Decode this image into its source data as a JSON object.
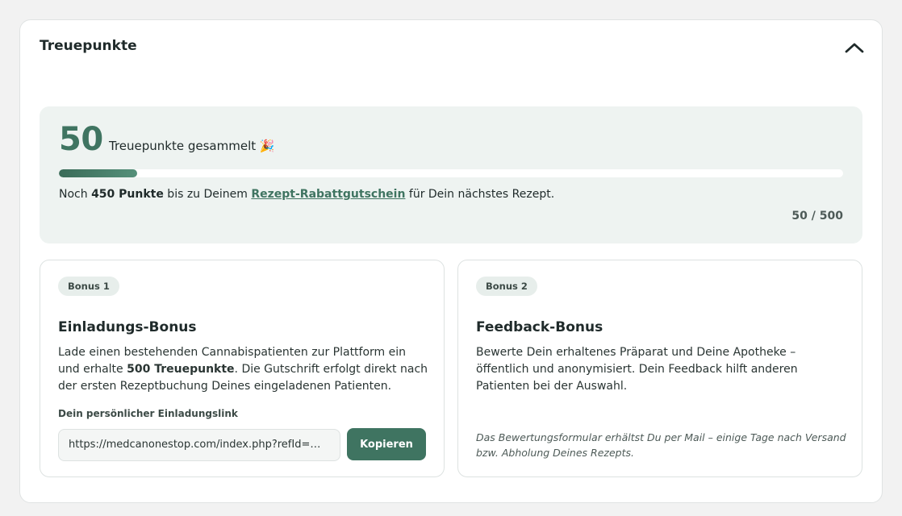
{
  "header": {
    "title": "Treuepunkte",
    "collapse_icon": "chevron-up-icon"
  },
  "points": {
    "collected": "50",
    "caption": "Treuepunkte gesammelt 🎉",
    "progress_fraction": 0.1,
    "note_prefix": "Noch ",
    "note_remaining": "450 Punkte",
    "note_middle": " bis zu Deinem ",
    "note_link": "Rezept-Rabattgutschein",
    "note_suffix": " für Dein nächstes Rezept.",
    "ratio": "50 / 500",
    "accent_color": "#3f7461"
  },
  "bonus1": {
    "badge": "Bonus 1",
    "title": "Einladungs-Bonus",
    "text_part1": "Lade einen bestehenden Cannabispatienten zur Plattform ein und erhalte ",
    "text_bold": "500 Treuepunkte",
    "text_part2": ". Die Gutschrift erfolgt direkt nach der ersten Rezeptbuchung Deines eingeladenen Patienten.",
    "link_label": "Dein persönlicher Einladungslink",
    "link_value": "https://medcanonestop.com/index.php?refId=…",
    "copy_label": "Kopieren"
  },
  "bonus2": {
    "badge": "Bonus 2",
    "title": "Feedback-Bonus",
    "text": "Bewerte Dein erhaltenes Präparat und Deine Apotheke – öffentlich und anonymisiert. Dein Feedback hilft anderen Patienten bei der Auswahl.",
    "hint": "Das Bewertungsformular erhältst Du per Mail – einige Tage nach Versand bzw. Abholung Deines Rezepts."
  }
}
